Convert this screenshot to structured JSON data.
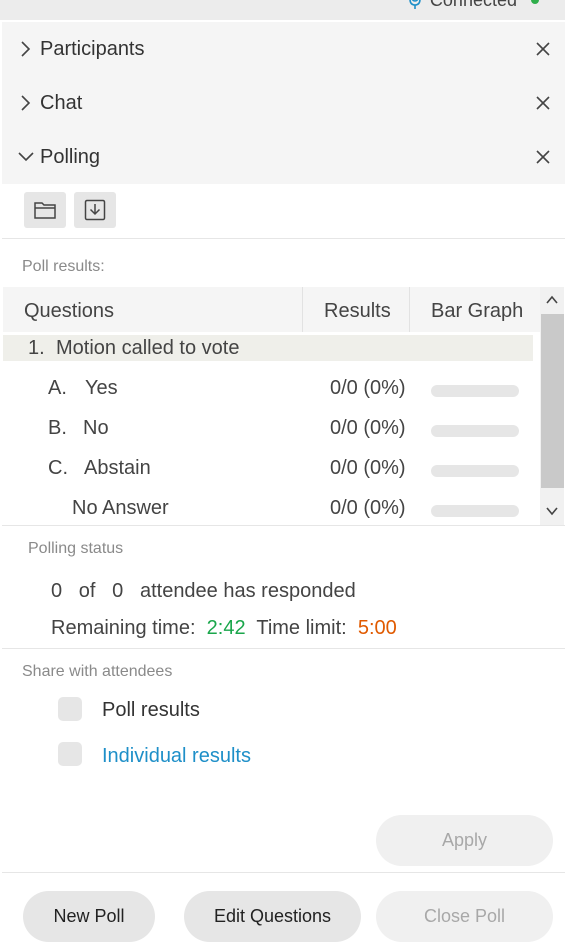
{
  "header": {
    "connection_status": "Connected",
    "status_color": "#2fae4b"
  },
  "sections": {
    "participants": {
      "title": "Participants",
      "icon": "chevron-right-icon"
    },
    "chat": {
      "title": "Chat",
      "icon": "chevron-right-icon"
    },
    "polling": {
      "title": "Polling",
      "icon": "chevron-down-icon"
    }
  },
  "toolbar": {
    "open_icon": "folder-icon",
    "save_icon": "download-icon"
  },
  "poll_results": {
    "label": "Poll results:",
    "columns": [
      "Questions",
      "Results",
      "Bar Graph"
    ],
    "question": {
      "number": "1.",
      "text": "Motion called to vote"
    },
    "answers": [
      {
        "letter": "A.",
        "text": "Yes",
        "result": "0/0 (0%)",
        "percent": 0
      },
      {
        "letter": "B.",
        "text": "No",
        "result": "0/0 (0%)",
        "percent": 0
      },
      {
        "letter": "C.",
        "text": "Abstain",
        "result": "0/0 (0%)",
        "percent": 0
      },
      {
        "letter": "",
        "text": "No Answer",
        "result": "0/0 (0%)",
        "percent": 0
      }
    ]
  },
  "polling_status": {
    "label": "Polling status",
    "responded": "0",
    "of_word": "of",
    "total": "0",
    "responded_text": "attendee has responded",
    "remaining_label": "Remaining time:",
    "remaining_value": "2:42",
    "limit_label": "Time limit:",
    "limit_value": "5:00"
  },
  "share": {
    "label": "Share with attendees",
    "options": [
      {
        "label": "Poll results",
        "checked": false
      },
      {
        "label": "Individual results",
        "checked": false
      }
    ],
    "apply_label": "Apply"
  },
  "footer": {
    "new_poll": "New Poll",
    "edit_questions": "Edit Questions",
    "close_poll": "Close Poll"
  },
  "colors": {
    "accent_link": "#1e8fc8",
    "remaining_time": "#1aa64b",
    "time_limit": "#e05a00"
  }
}
